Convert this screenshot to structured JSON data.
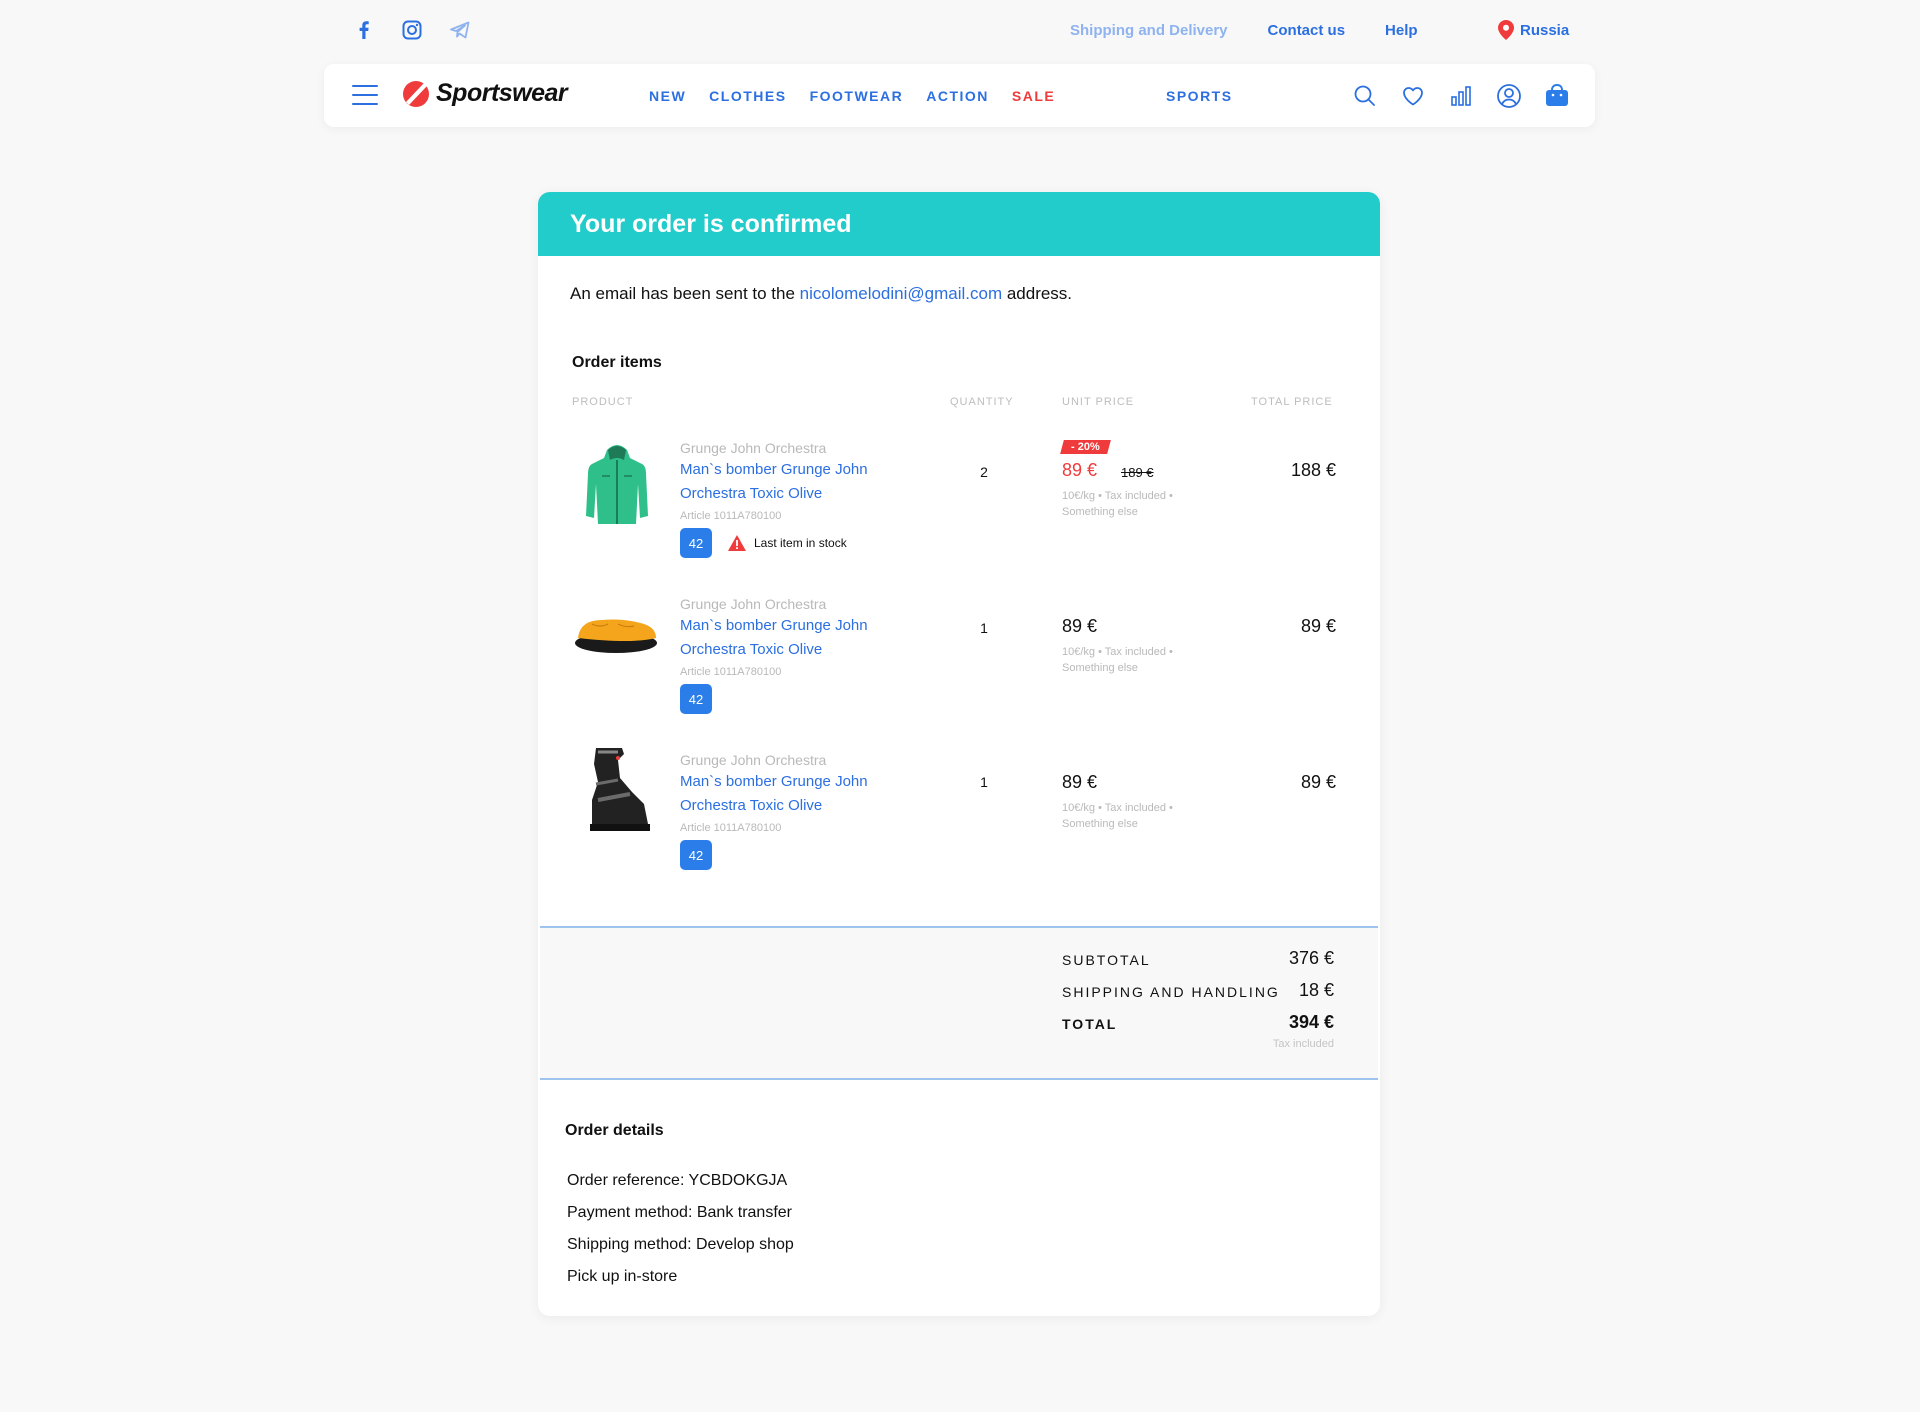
{
  "topbar": {
    "social": [
      "facebook-icon",
      "instagram-icon",
      "telegram-icon"
    ],
    "links": [
      "Shipping and Delivery",
      "Contact us",
      "Help"
    ],
    "region": "Russia"
  },
  "nav": {
    "logo_text": "Sportswear",
    "items": [
      "NEW",
      "CLOTHES",
      "FOOTWEAR",
      "ACTION",
      "SALE"
    ],
    "sports": "SPORTS",
    "icons": [
      "search-icon",
      "heart-icon",
      "chart-icon",
      "user-icon",
      "bag-icon"
    ]
  },
  "order": {
    "title": "Your order is confirmed",
    "email_prefix": "An email has been sent to the ",
    "email": "nicolomelodini@gmail.com",
    "email_suffix": " address.",
    "items_title": "Order items",
    "columns": [
      "PRODUCT",
      "QUANTITY",
      "UNIT PRICE",
      "TOTAL PRICE"
    ],
    "items": [
      {
        "brand": "Grunge John Orchestra",
        "name": "Man`s bomber Grunge John Orchestra Toxic Olive",
        "article": "Article 1011A780100",
        "size": "42",
        "stock_warning": "Last item in stock",
        "quantity": "2",
        "discount": "- 20%",
        "price": "89 €",
        "old_price": "189 €",
        "unit_note": "10€/kg • Tax included • Something else",
        "total": "188 €",
        "image": "green-jacket"
      },
      {
        "brand": "Grunge John Orchestra",
        "name": "Man`s bomber Grunge John Orchestra Toxic Olive",
        "article": "Article 1011A780100",
        "size": "42",
        "quantity": "1",
        "price": "89 €",
        "unit_note": "10€/kg • Tax included • Something else",
        "total": "89 €",
        "image": "yellow-slipper"
      },
      {
        "brand": "Grunge John Orchestra",
        "name": "Man`s bomber Grunge John Orchestra Toxic Olive",
        "article": "Article 1011A780100",
        "size": "42",
        "quantity": "1",
        "price": "89 €",
        "unit_note": "10€/kg • Tax included • Something else",
        "total": "89 €",
        "image": "ski-boot"
      }
    ],
    "summary": {
      "subtotal_label": "SUBTOTAL",
      "subtotal": "376 €",
      "shipping_label": "SHIPPING AND HANDLING",
      "shipping": "18 €",
      "total_label": "TOTAL",
      "total": "394 €",
      "tax_note": "Tax included"
    },
    "details_title": "Order details",
    "details": [
      "Order reference: YCBDOKGJA",
      "Payment method: Bank transfer",
      "Shipping method: Develop shop",
      "Pick up in-store"
    ]
  },
  "colors": {
    "accent": "#2b6fe0",
    "header_teal": "#22cccb",
    "sale_red": "#ef3b3b"
  }
}
